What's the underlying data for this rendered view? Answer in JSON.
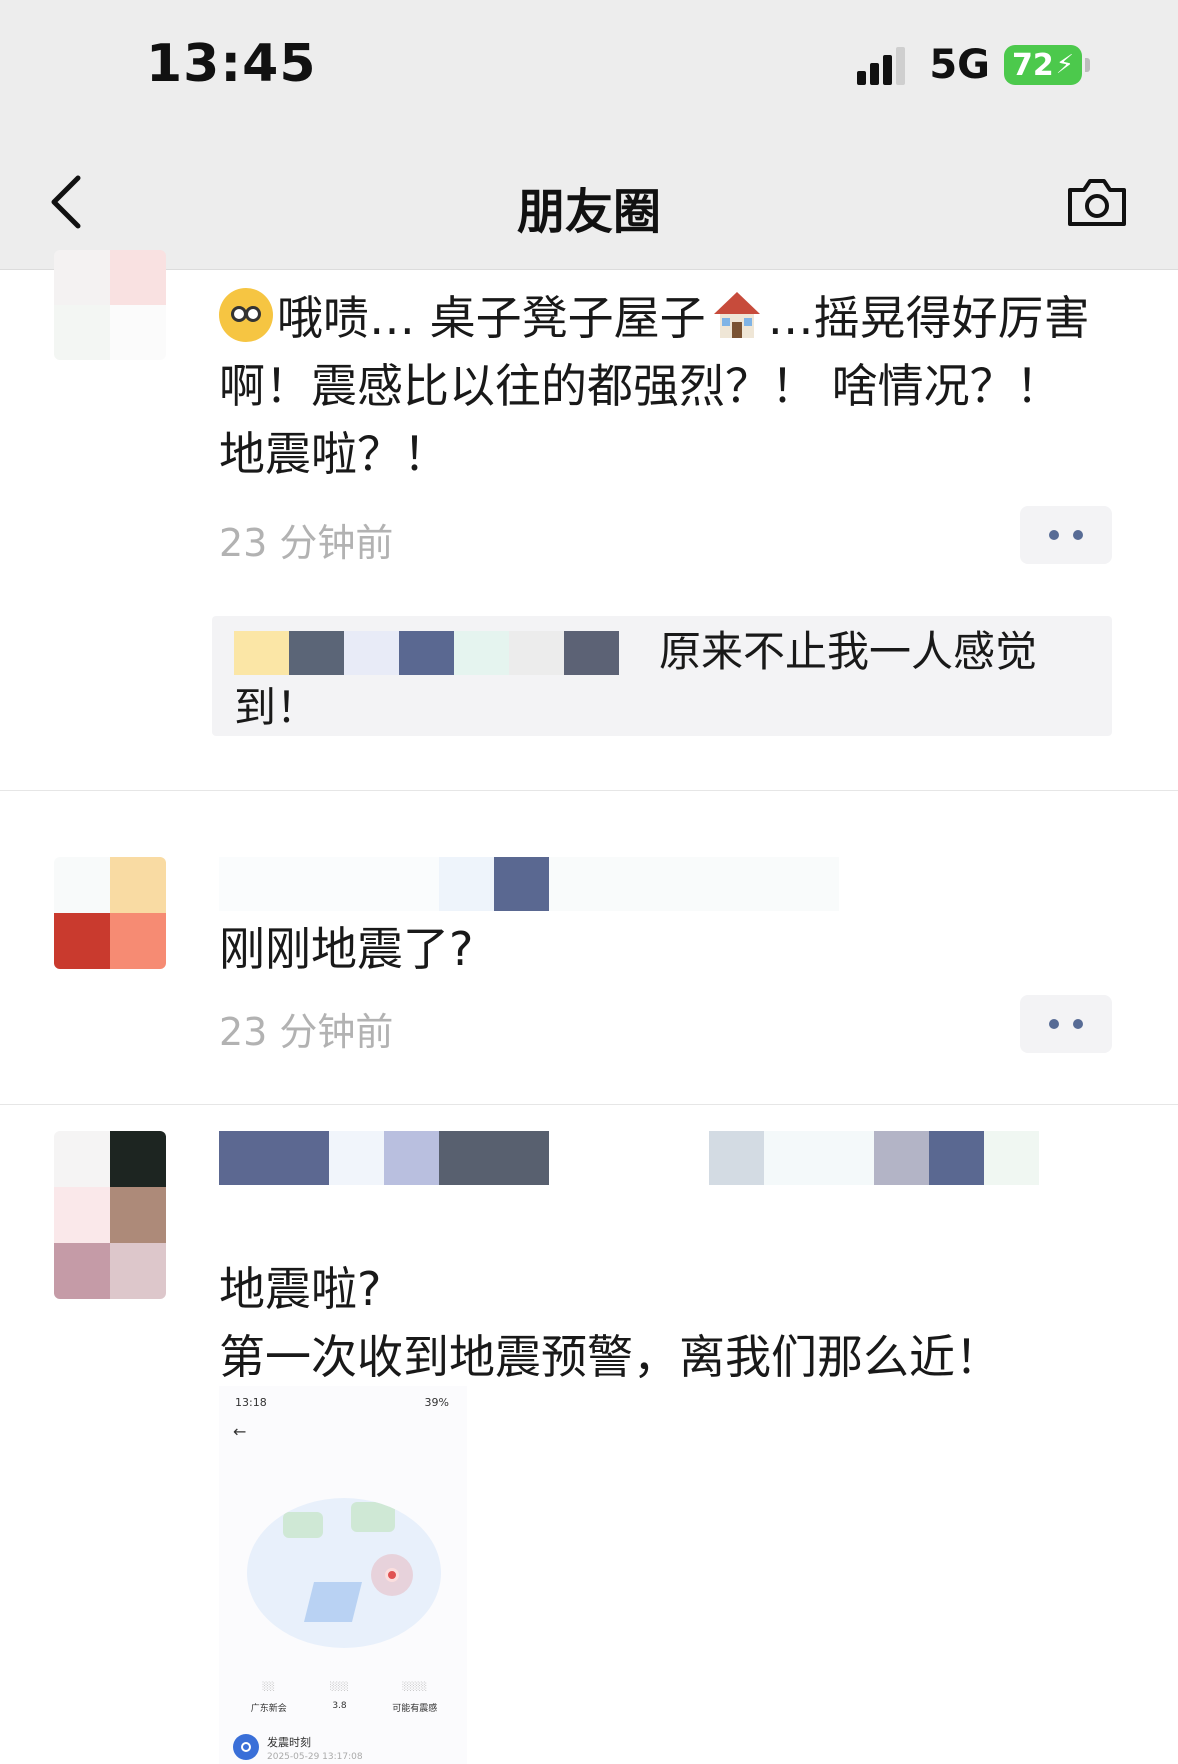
{
  "status_bar": {
    "time": "13:45",
    "network": "5G",
    "battery": "72"
  },
  "nav": {
    "title": "朋友圈",
    "back_icon": "chevron-left-icon",
    "camera_icon": "camera-icon"
  },
  "posts": [
    {
      "text_part1": "哦啧… 桌子凳子屋子",
      "text_part2": "…摇晃得好厉害啊！震感比以往的都强烈？！ 啥情况？！ 地震啦？！",
      "time": "23 分钟前",
      "comment": "原来不止我一人感觉到！"
    },
    {
      "text": "刚刚地震了?",
      "time": "23 分钟前"
    },
    {
      "text_line1": "地震啦?",
      "text_line2": "第一次收到地震预警，离我们那么近！",
      "thumbnail": {
        "time": "13:18",
        "status": "39%",
        "col1_value": "广东新会",
        "col2_value": "3.8",
        "col3_value": "可能有震感",
        "footer_title": "发震时刻",
        "footer_value": "2025-05-29 13:17:08"
      }
    }
  ],
  "colors": {
    "link_blue": "#576b95",
    "time_gray": "#b2b2b2",
    "nav_bg": "#ededed",
    "battery_green": "#4cc94c"
  }
}
